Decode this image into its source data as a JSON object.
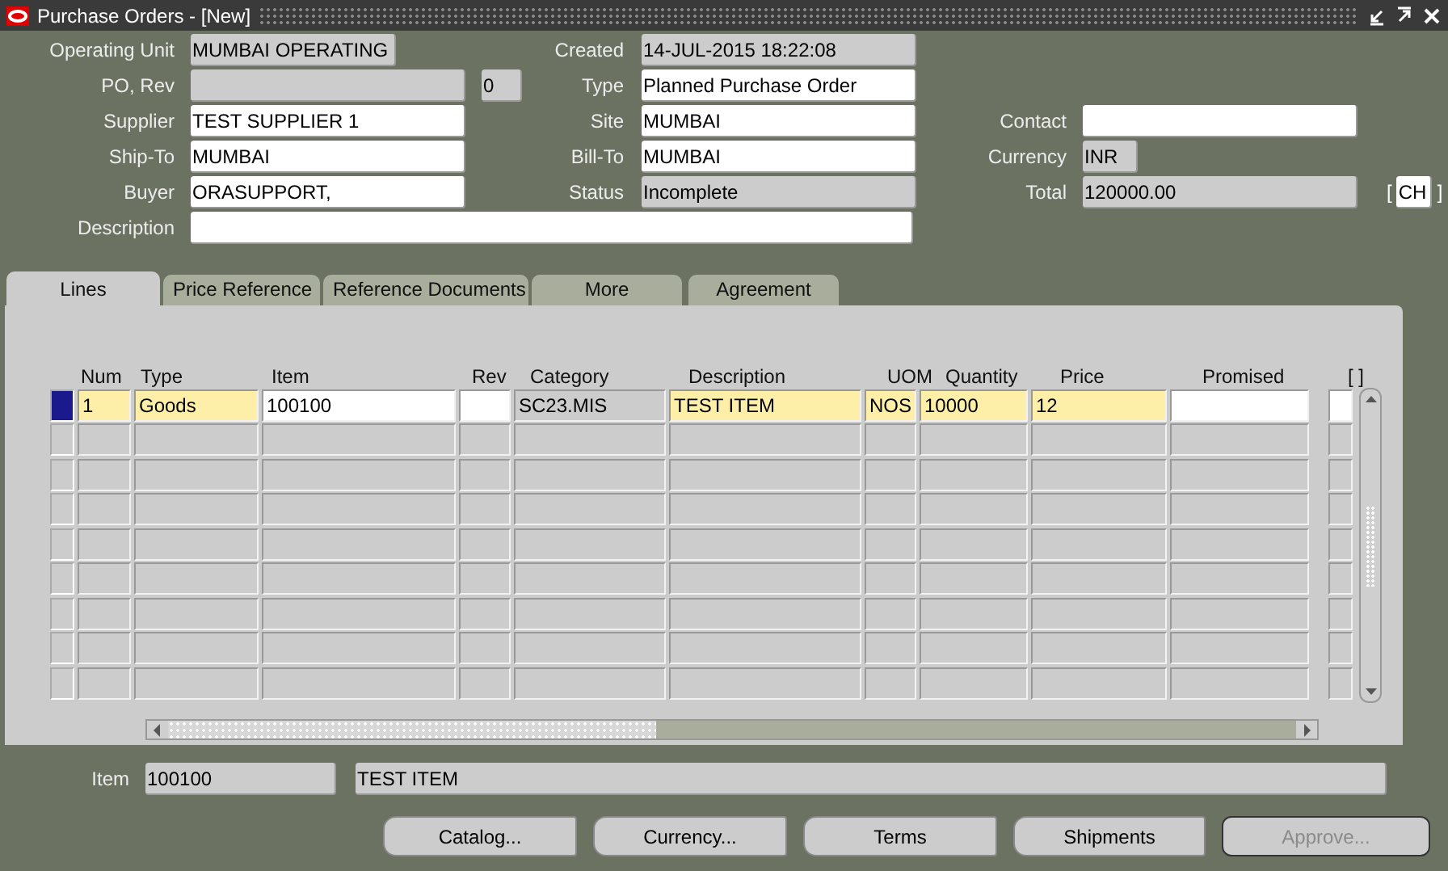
{
  "window": {
    "title": "Purchase Orders - [New]"
  },
  "header": {
    "rows": [
      {
        "left": {
          "label": "Operating Unit",
          "value": "MUMBAI OPERATING",
          "editable": false,
          "kind": "medium"
        },
        "middle": {
          "label": "Created",
          "value": "14-JUL-2015 18:22:08",
          "editable": false,
          "kind": "normal"
        }
      },
      {
        "left": {
          "label": "PO, Rev",
          "editable": false,
          "kind": "normal",
          "rev": {
            "value": "0",
            "editable": false
          }
        },
        "middle": {
          "label": "Type",
          "value": "Planned Purchase Order",
          "editable": true,
          "kind": "normal"
        }
      },
      {
        "left": {
          "label": "Supplier",
          "value": "TEST SUPPLIER 1",
          "editable": true,
          "kind": "normal"
        },
        "middle": {
          "label": "Site",
          "value": "MUMBAI",
          "editable": true,
          "kind": "normal"
        },
        "right": {
          "label": "Contact",
          "editable": true,
          "kind": "normal"
        }
      },
      {
        "left": {
          "label": "Ship-To",
          "value": "MUMBAI",
          "editable": true,
          "kind": "normal"
        },
        "middle": {
          "label": "Bill-To",
          "value": "MUMBAI",
          "editable": true,
          "kind": "normal"
        },
        "right": {
          "label": "Currency",
          "value": "INR",
          "editable": false,
          "kind": "short"
        }
      },
      {
        "left": {
          "label": "Buyer",
          "value": "ORASUPPORT,",
          "editable": true,
          "kind": "normal"
        },
        "middle": {
          "label": "Status",
          "value": "Incomplete",
          "editable": false,
          "kind": "normal"
        },
        "right": {
          "label": "Total",
          "value": "120000.00",
          "editable": false,
          "kind": "normal",
          "flex": {
            "open": "[",
            "value": "CH",
            "close": "]"
          }
        }
      },
      {
        "left": {
          "label": "Description",
          "editable": true,
          "kind": "wide"
        }
      }
    ]
  },
  "tabs": [
    {
      "label": "Lines",
      "selected": true
    },
    {
      "label": "Price Reference",
      "selected": false
    },
    {
      "label": "Reference Documents",
      "selected": false
    },
    {
      "label": "More",
      "selected": false
    },
    {
      "label": "Agreement",
      "selected": false
    }
  ],
  "table": {
    "columns": [
      "Num",
      "Type",
      "Item",
      "Rev",
      "Category",
      "Description",
      "UOM",
      "Quantity",
      "Price",
      "Promised",
      "[ ]"
    ],
    "rows": [
      {
        "selected": true,
        "cells": [
          {
            "text": "1",
            "kind": "required"
          },
          {
            "text": "Goods",
            "kind": "required"
          },
          {
            "text": "100100",
            "kind": "editable"
          },
          {
            "kind": "editable"
          },
          {
            "text": "SC23.MIS",
            "kind": "readonly"
          },
          {
            "text": "TEST ITEM",
            "kind": "required"
          },
          {
            "text": "NOS",
            "kind": "required"
          },
          {
            "text": "10000",
            "kind": "required"
          },
          {
            "text": "12",
            "kind": "required"
          },
          {
            "kind": "editable"
          },
          {
            "kind": "editable"
          }
        ]
      },
      {
        "selected": false
      },
      {
        "selected": false
      },
      {
        "selected": false
      },
      {
        "selected": false
      },
      {
        "selected": false
      },
      {
        "selected": false
      },
      {
        "selected": false
      },
      {
        "selected": false
      }
    ]
  },
  "footer": {
    "label": "Item",
    "item": "100100",
    "description": "TEST ITEM"
  },
  "buttons": [
    {
      "label": "Catalog...",
      "disabled": false
    },
    {
      "label": "Currency...",
      "disabled": false
    },
    {
      "label": "Terms",
      "disabled": false
    },
    {
      "label": "Shipments",
      "disabled": false
    },
    {
      "label": "Approve...",
      "disabled": true
    }
  ]
}
